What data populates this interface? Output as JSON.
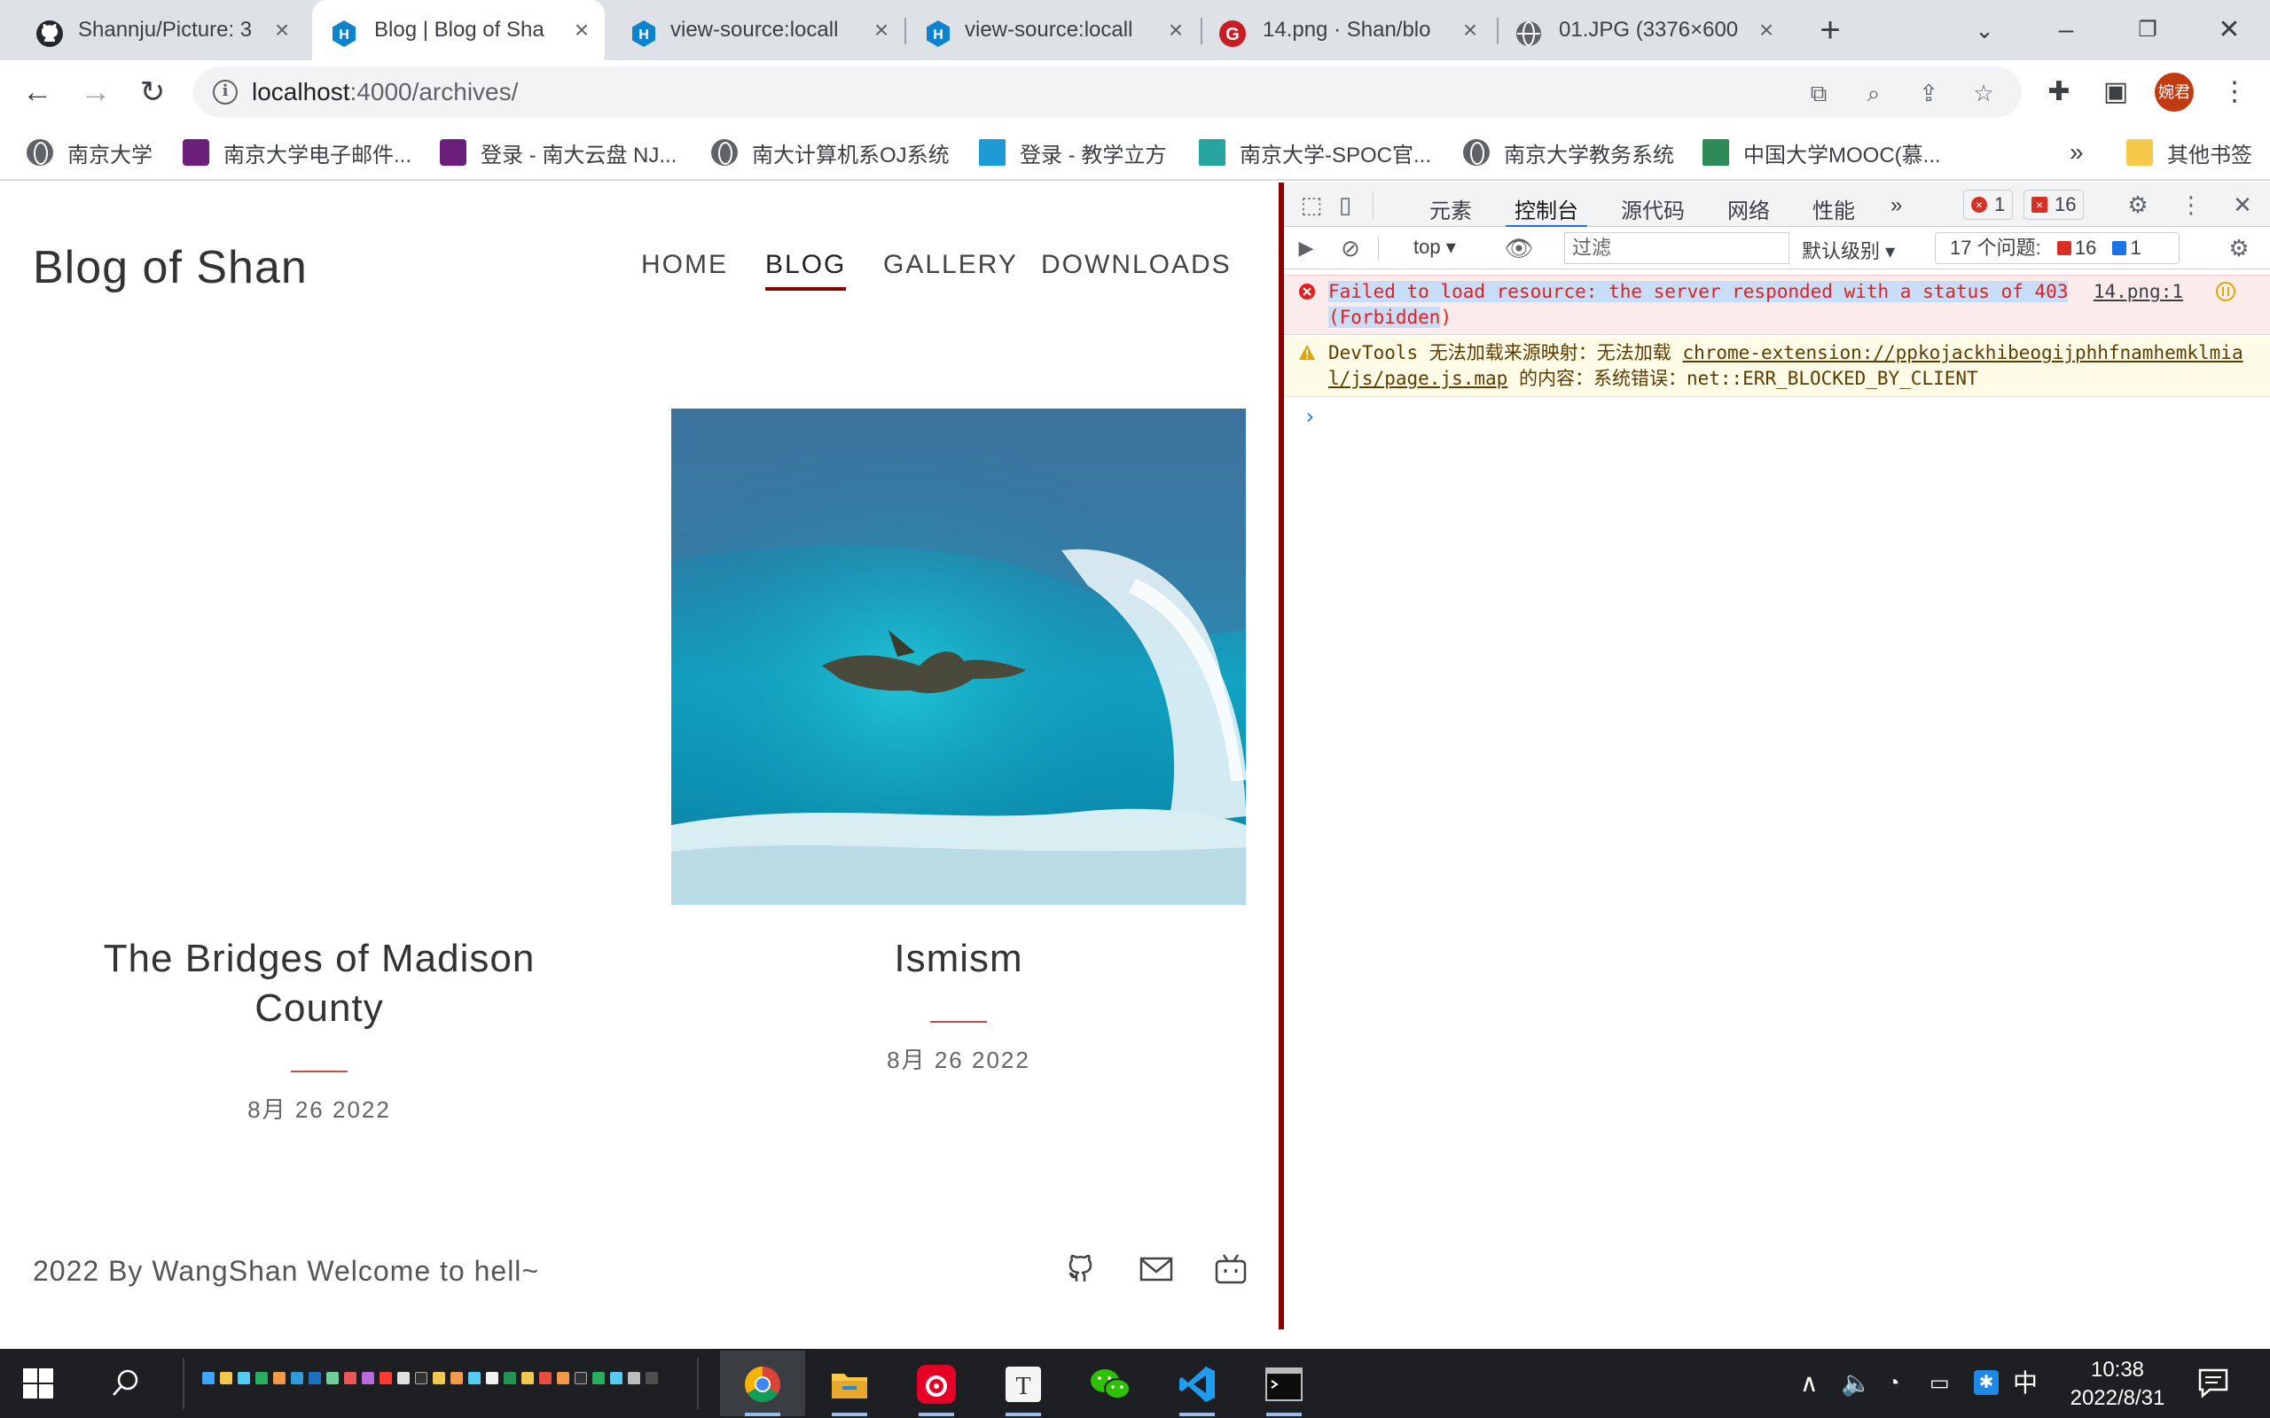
{
  "tabs": [
    {
      "title": "Shannju/Picture: 3",
      "icon": "github-icon"
    },
    {
      "title": "Blog | Blog of Sha",
      "icon": "hexo-icon"
    },
    {
      "title": "view-source:locall",
      "icon": "hexo-icon"
    },
    {
      "title": "view-source:locall",
      "icon": "hexo-icon"
    },
    {
      "title": "14.png · Shan/blo",
      "icon": "gitee-icon"
    },
    {
      "title": "01.JPG (3376×600",
      "icon": "globe-icon"
    }
  ],
  "toolbar": {
    "url_host": "localhost",
    "url_rest": ":4000/archives/",
    "profile": "婉君"
  },
  "bookmarks": [
    "南京大学",
    "南京大学电子邮件...",
    "登录 - 南大云盘 NJ...",
    "南大计算机系OJ系统",
    "登录 - 教学立方",
    "南京大学-SPOC官...",
    "南京大学教务系统",
    "中国大学MOOC(慕...",
    "»",
    "其他书签"
  ],
  "site": {
    "title": "Blog of Shan",
    "nav": [
      "HOME",
      "BLOG",
      "GALLERY",
      "DOWNLOADS"
    ],
    "active_nav": "BLOG",
    "posts": [
      {
        "title_line1": "The Bridges of Madison",
        "title_line2": "County",
        "date": "8月 26 2022"
      },
      {
        "title": "Ismism",
        "date": "8月 26 2022"
      }
    ],
    "footer": "2022 By WangShan  Welcome to hell~"
  },
  "devtools": {
    "tabs": [
      "元素",
      "控制台",
      "源代码",
      "网络",
      "性能",
      "»"
    ],
    "active_tab": "控制台",
    "error_count": "1",
    "issue_badge_count": "16",
    "context": "top",
    "filter_placeholder": "过滤",
    "level": "默认级别",
    "issues_label": "17 个问题:",
    "issues_errors": "16",
    "issues_info": "1",
    "error_msg_part1": "Failed to load resource: the server responded with a status of 403 (Forbidden",
    "error_msg_part2": ")",
    "error_source": "14.png:1",
    "warn_prefix": "DevTools 无法加载来源映射：无法加载 ",
    "warn_url": "chrome-extension://ppkojackhibeogijphhfnamhemklmial/js/page.js.map",
    "warn_suffix": " 的内容：系统错误：net::ERR_BLOCKED_BY_CLIENT",
    "prompt": "›"
  },
  "taskbar": {
    "time": "10:38",
    "date": "2022/8/31",
    "ime": "中"
  },
  "colors": {
    "accent_dark_red": "#8b0000",
    "devtools_error": "#e41e1e",
    "chrome_blue": "#1a73e8"
  }
}
